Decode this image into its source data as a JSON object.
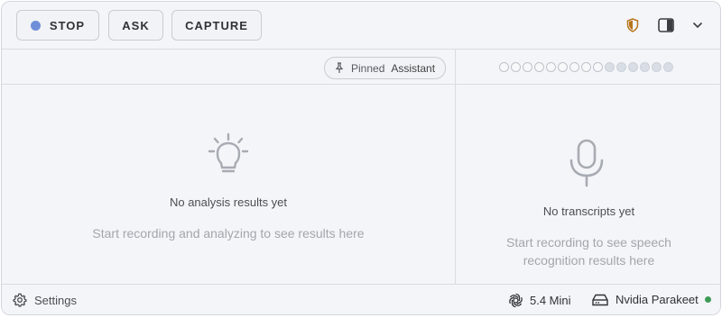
{
  "toolbar": {
    "stop_label": "STOP",
    "ask_label": "ASK",
    "capture_label": "CAPTURE",
    "recording_color": "#6f8fd8",
    "icons": [
      "shield-icon",
      "panel-toggle-icon",
      "chevron-down-icon"
    ]
  },
  "analysis_header": {
    "pinned_label": "Pinned",
    "pinned_value": "Assistant"
  },
  "transcript_header": {
    "progress_dots_total": 15,
    "progress_dots_filled": 6
  },
  "analysis_panel": {
    "icon": "lightbulb-icon",
    "title": "No analysis results yet",
    "subtitle": "Start recording and analyzing to see results here"
  },
  "transcript_panel": {
    "icon": "microphone-icon",
    "title": "No transcripts yet",
    "subtitle_line1": "Start recording to see speech",
    "subtitle_line2": "recognition results here"
  },
  "footer": {
    "settings_label": "Settings",
    "model_label": "5.4 Mini",
    "engine_label": "Nvidia Parakeet",
    "engine_status_color": "#3f9b58"
  }
}
